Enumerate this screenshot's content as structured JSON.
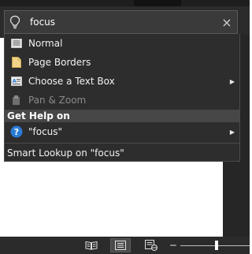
{
  "search": {
    "value": "focus",
    "icon": "lightbulb-icon",
    "clear_icon": "close-icon",
    "clear_glyph": "×"
  },
  "menu": {
    "items": [
      {
        "label": "Normal",
        "icon": "normal-view-icon"
      },
      {
        "label": "Page Borders",
        "icon": "page-borders-icon"
      },
      {
        "label": "Choose a Text Box",
        "icon": "text-box-icon",
        "submenu": true
      },
      {
        "label": "Pan & Zoom",
        "icon": "pan-zoom-icon",
        "disabled": true
      }
    ],
    "help_header": "Get Help on",
    "help_item": {
      "label": "\"focus\"",
      "icon": "help-icon",
      "icon_glyph": "?",
      "submenu": true
    },
    "smart_lookup": "Smart Lookup on \"focus\"",
    "submenu_glyph": "▶"
  },
  "statusbar": {
    "zoom_minus_glyph": "‒",
    "buttons": [
      "read-mode-icon",
      "print-layout-icon",
      "web-layout-icon"
    ],
    "zoom_level": 0.5
  }
}
